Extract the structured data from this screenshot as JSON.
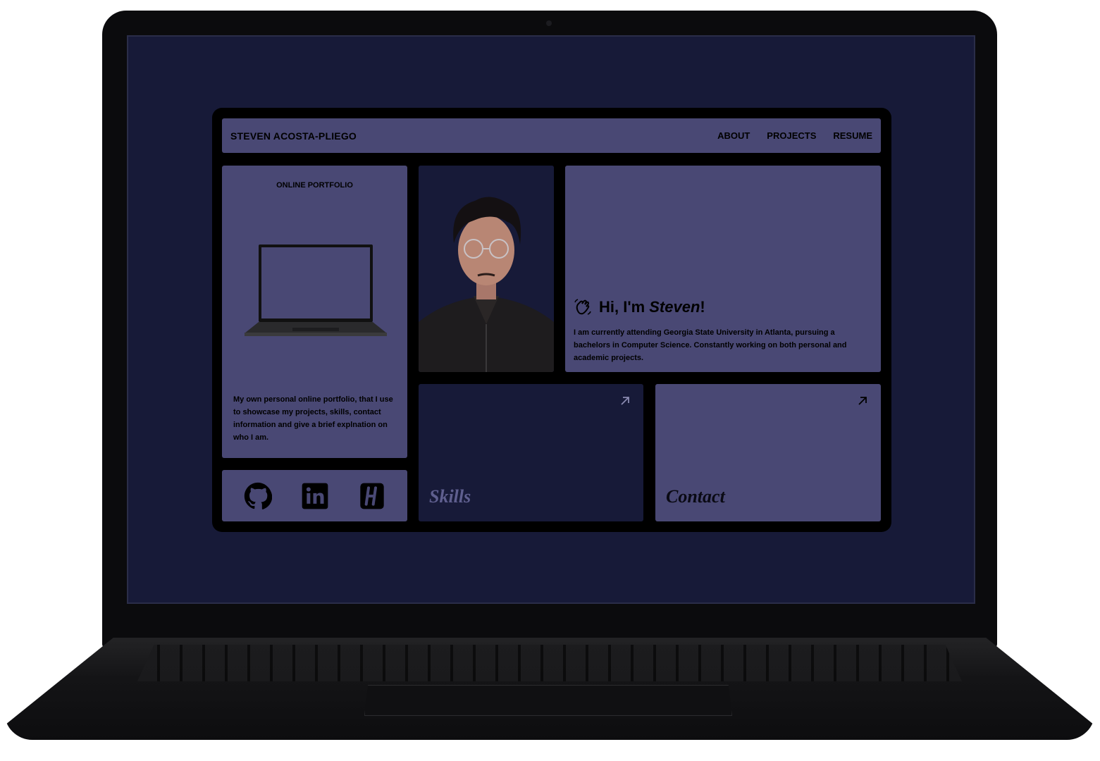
{
  "nav": {
    "brand": "STEVEN ACOSTA-PLIEGO",
    "links": [
      "ABOUT",
      "PROJECTS",
      "RESUME"
    ]
  },
  "portfolio": {
    "title": "ONLINE PORTFOLIO",
    "description": "My own personal online portfolio, that I use to showcase my projects, skills, contact information and give a brief explnation on who I am."
  },
  "intro": {
    "greeting": "Hi, I'm ",
    "name": "Steven",
    "exclamation": "!",
    "text": "I am currently attending Georgia State University in Atlanta, pursuing a bachelors in Computer Science. Constantly working on both personal and academic projects."
  },
  "cards": {
    "skills": "Skills",
    "contact": "Contact"
  },
  "socials": [
    "github-icon",
    "linkedin-icon",
    "hashnode-icon"
  ],
  "colors": {
    "panel": "#494874",
    "dark_panel": "#171a38",
    "background": "#000000"
  }
}
